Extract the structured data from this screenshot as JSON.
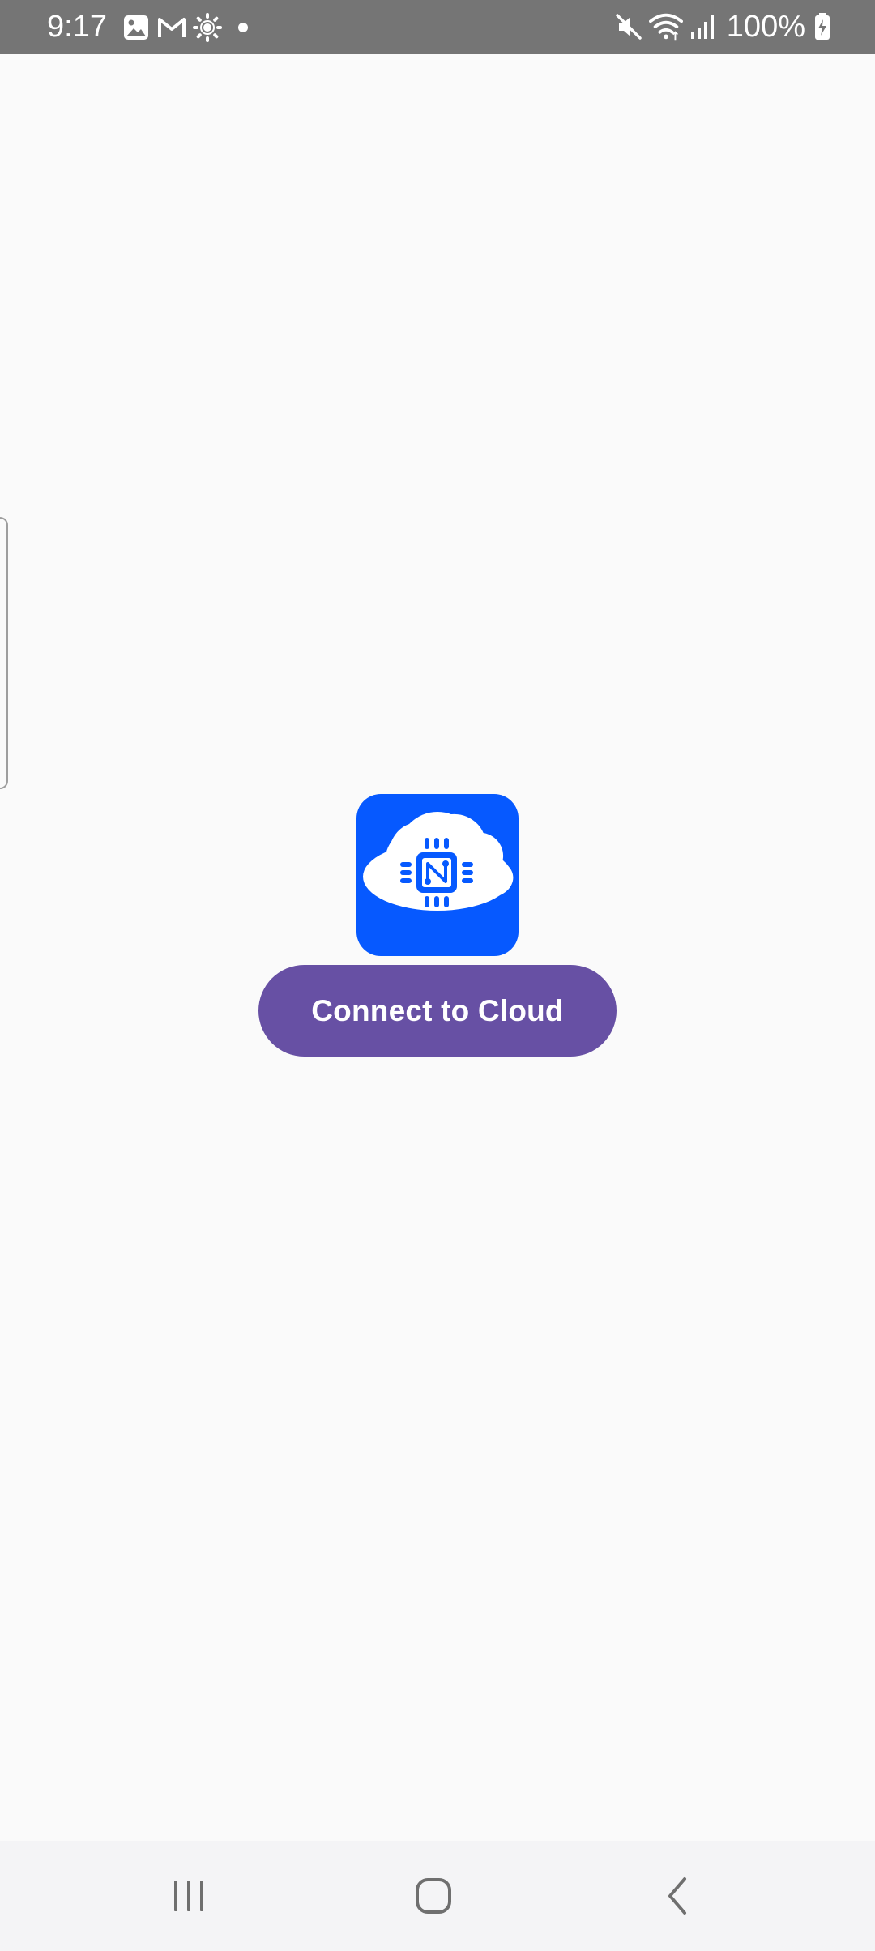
{
  "status_bar": {
    "time": "9:17",
    "left_icons": [
      "gallery-icon",
      "gmail-icon",
      "brightness-icon",
      "dot-icon"
    ],
    "right_icons": [
      "mute-icon",
      "wifi-icon",
      "signal-icon"
    ],
    "battery_percent": "100%",
    "background_color": "#757575"
  },
  "main": {
    "logo_icon": "cloud-chip-icon",
    "logo_color": "#0659ff",
    "connect_button_label": "Connect to Cloud",
    "connect_button_color": "#6750a4"
  },
  "nav_bar": {
    "buttons": [
      "recents-icon",
      "home-icon",
      "back-icon"
    ]
  }
}
